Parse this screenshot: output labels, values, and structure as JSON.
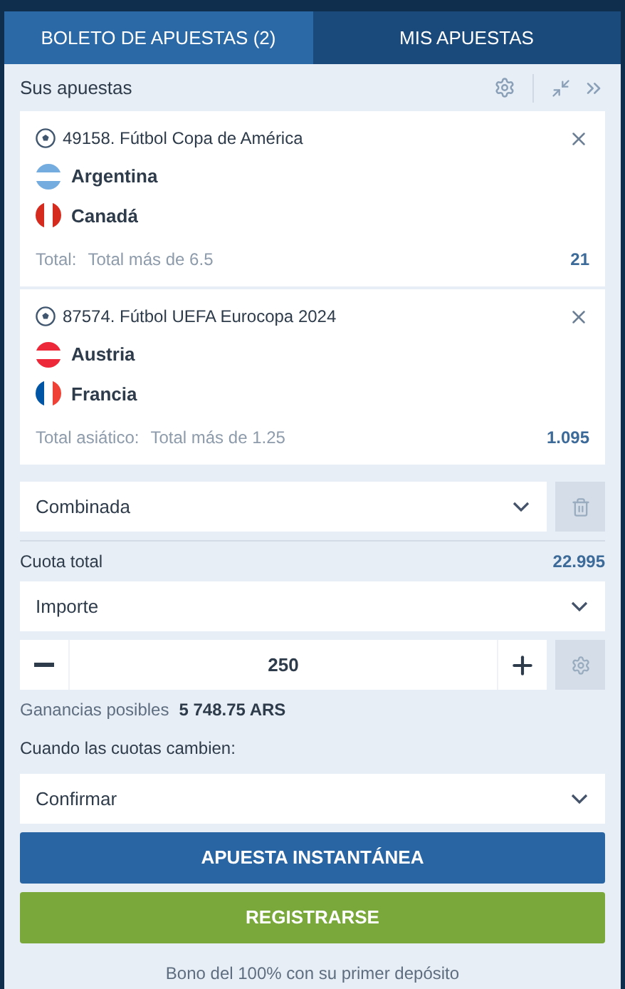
{
  "tabs": [
    {
      "label": "BOLETO DE APUESTAS (2)",
      "selected": true
    },
    {
      "label": "MIS APUESTAS",
      "selected": false
    }
  ],
  "header": {
    "title": "Sus apuestas"
  },
  "bets": [
    {
      "event": "49158. Fútbol Copa de América",
      "teams": [
        {
          "name": "Argentina",
          "kind": "horizontal",
          "color": "#74acdf"
        },
        {
          "name": "Canadá",
          "kind": "vertical",
          "color": "#d52b1e"
        }
      ],
      "market": "Total:",
      "outcome": "Total más de 6.5",
      "odds": "21"
    },
    {
      "event": "87574. Fútbol UEFA Eurocopa 2024",
      "teams": [
        {
          "name": "Austria",
          "kind": "horizontal",
          "color": "#ed2939"
        },
        {
          "name": "Francia",
          "kind": "tricolor",
          "color": "#0055a4"
        }
      ],
      "market": "Total asiático:",
      "outcome": "Total más de 1.25",
      "odds": "1.095"
    }
  ],
  "bet_type": {
    "value": "Combinada"
  },
  "total_odds": {
    "label": "Cuota total",
    "value": "22.995"
  },
  "amount_mode": {
    "value": "Importe"
  },
  "stake": {
    "value": "250"
  },
  "winnings": {
    "label": "Ganancias posibles",
    "value": "5 748.75 ARS"
  },
  "odds_change": {
    "label": "Cuando las cuotas cambien:",
    "value": "Confirmar"
  },
  "buttons": [
    {
      "label": "APUESTA INSTANTÁNEA",
      "kind": "primary"
    },
    {
      "label": "REGISTRARSE",
      "kind": "secondary"
    }
  ],
  "promo": "Bono del 100% con su primer depósito"
}
